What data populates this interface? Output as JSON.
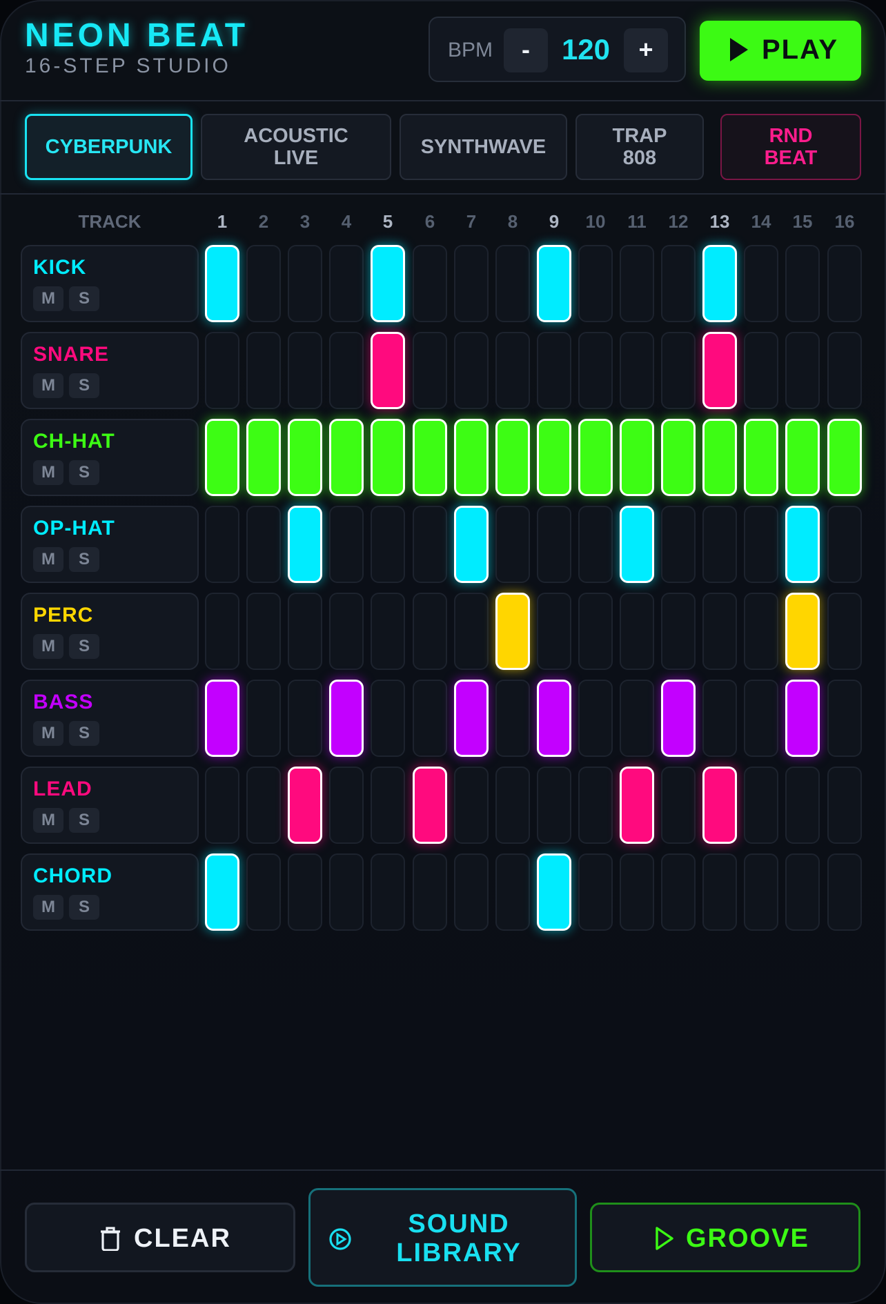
{
  "app": {
    "title": "NEON BEAT",
    "subtitle": "16-STEP STUDIO"
  },
  "bpm": {
    "label": "BPM",
    "value": "120",
    "minus": "-",
    "plus": "+"
  },
  "transport": {
    "play_label": "PLAY"
  },
  "presets": [
    {
      "label": "CYBERPUNK",
      "active": true
    },
    {
      "label": "ACOUSTIC LIVE",
      "active": false
    },
    {
      "label": "SYNTHWAVE",
      "active": false
    },
    {
      "label": "TRAP 808",
      "active": false
    },
    {
      "label": "RND BEAT",
      "active": false
    }
  ],
  "grid": {
    "track_header": "TRACK",
    "steps": [
      "1",
      "2",
      "3",
      "4",
      "5",
      "6",
      "7",
      "8",
      "9",
      "10",
      "11",
      "12",
      "13",
      "14",
      "15",
      "16"
    ],
    "mute_label": "M",
    "solo_label": "S"
  },
  "tracks": [
    {
      "name": "KICK",
      "color": "#00ecff",
      "steps": [
        1,
        5,
        9,
        13
      ]
    },
    {
      "name": "SNARE",
      "color": "#ff0a7e",
      "steps": [
        5,
        13
      ]
    },
    {
      "name": "CH-HAT",
      "color": "#3dfd14",
      "steps": [
        1,
        2,
        3,
        4,
        5,
        6,
        7,
        8,
        9,
        10,
        11,
        12,
        13,
        14,
        15,
        16
      ]
    },
    {
      "name": "OP-HAT",
      "color": "#00ecff",
      "steps": [
        3,
        7,
        11,
        15
      ]
    },
    {
      "name": "PERC",
      "color": "#ffd600",
      "steps": [
        8,
        15
      ]
    },
    {
      "name": "BASS",
      "color": "#c300ff",
      "steps": [
        1,
        4,
        7,
        9,
        12,
        15
      ]
    },
    {
      "name": "LEAD",
      "color": "#ff0a7e",
      "steps": [
        3,
        6,
        11,
        13
      ]
    },
    {
      "name": "CHORD",
      "color": "#00ecff",
      "steps": [
        1,
        9
      ]
    }
  ],
  "actions": {
    "clear_label": "CLEAR",
    "library_label": "SOUND LIBRARY",
    "groove_label": "GROOVE"
  },
  "colors": {
    "accent": "#17e9f6",
    "play": "#3cfa14",
    "rnd": "#ff1d8d"
  }
}
